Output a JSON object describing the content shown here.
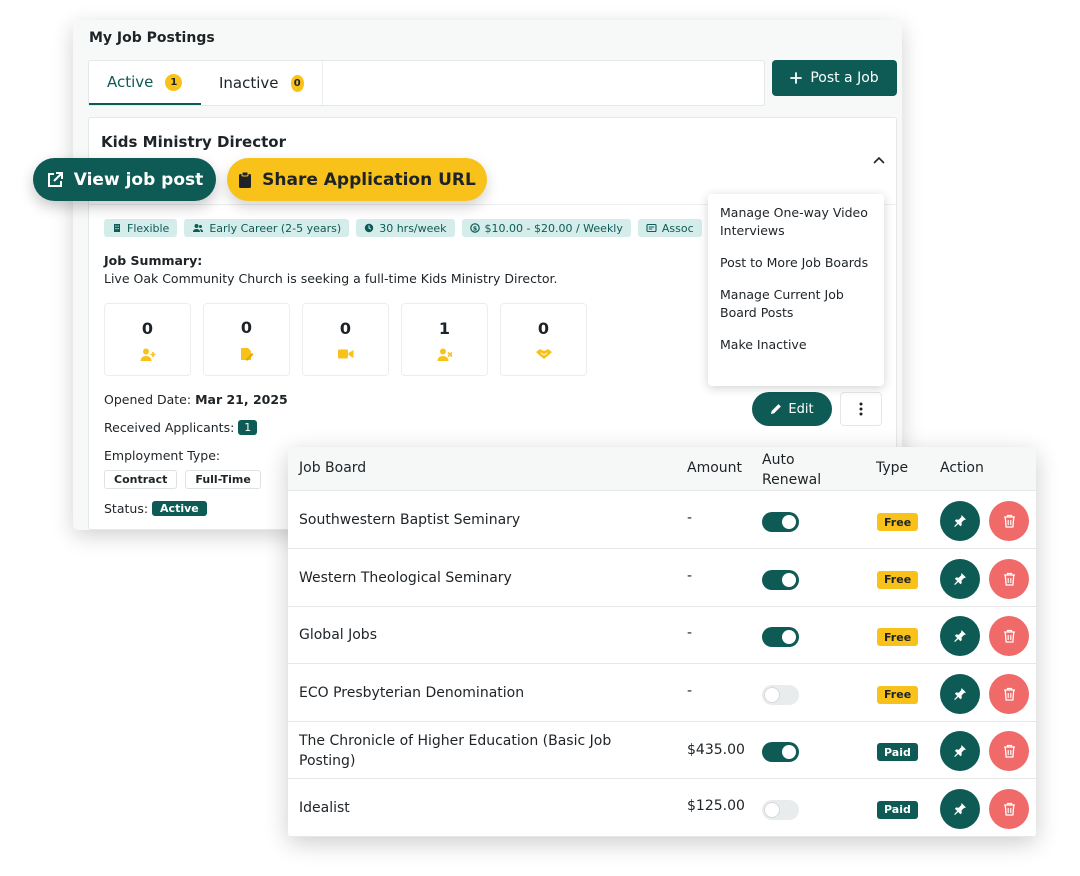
{
  "panel": {
    "title": "My Job Postings",
    "tabs": [
      {
        "label": "Active",
        "count": "1"
      },
      {
        "label": "Inactive",
        "count": "0"
      }
    ],
    "post_button": "Post a Job"
  },
  "job": {
    "title": "Kids Ministry Director",
    "tags": [
      {
        "label": "Flexible",
        "icon": "building-icon"
      },
      {
        "label": "Early Career (2-5 years)",
        "icon": "people-icon"
      },
      {
        "label": "30 hrs/week",
        "icon": "clock-icon"
      },
      {
        "label": "$10.00 - $20.00 / Weekly",
        "icon": "money-icon"
      },
      {
        "label": "Assoc",
        "icon": "certificate-icon"
      }
    ],
    "summary_label": "Job Summary:",
    "summary_text": "Live Oak Community Church is seeking a full-time Kids Ministry Director.",
    "stats": [
      {
        "value": "0",
        "icon": "user-plus-icon"
      },
      {
        "value": "0",
        "icon": "file-edit-icon"
      },
      {
        "value": "0",
        "icon": "video-icon"
      },
      {
        "value": "1",
        "icon": "user-remove-icon"
      },
      {
        "value": "0",
        "icon": "handshake-icon"
      }
    ],
    "opened_label": "Opened Date:",
    "opened_date": "Mar 21, 2025",
    "received_label": "Received Applicants:",
    "received_count": "1",
    "employment_label": "Employment Type:",
    "employment_types": [
      "Contract",
      "Full-Time"
    ],
    "status_label": "Status:",
    "status_value": "Active",
    "edit_label": "Edit"
  },
  "dropdown": {
    "items": [
      "Manage One-way Video Interviews",
      "Post to More Job Boards",
      "Manage Current Job Board Posts",
      "Make Inactive"
    ]
  },
  "pills": {
    "view": "View job post",
    "share": "Share Application URL"
  },
  "board": {
    "headers": {
      "job_board": "Job Board",
      "amount": "Amount",
      "auto_renewal": "Auto Renewal",
      "type": "Type",
      "action": "Action"
    },
    "rows": [
      {
        "name": "Southwestern Baptist Seminary",
        "amount": "-",
        "auto_renewal": true,
        "type": "Free"
      },
      {
        "name": "Western Theological Seminary",
        "amount": "-",
        "auto_renewal": true,
        "type": "Free"
      },
      {
        "name": "Global Jobs",
        "amount": "-",
        "auto_renewal": true,
        "type": "Free"
      },
      {
        "name": "ECO Presbyterian Denomination",
        "amount": "-",
        "auto_renewal": false,
        "type": "Free"
      },
      {
        "name": "The Chronicle of Higher Education  (Basic Job Posting)",
        "amount": "$435.00",
        "auto_renewal": true,
        "type": "Paid"
      },
      {
        "name": "Idealist",
        "amount": "$125.00",
        "auto_renewal": false,
        "type": "Paid"
      }
    ]
  },
  "colors": {
    "primary": "#0e5a55",
    "accent": "#f8c21a",
    "danger": "#f06a6a",
    "tag_bg": "#d4ecea"
  }
}
